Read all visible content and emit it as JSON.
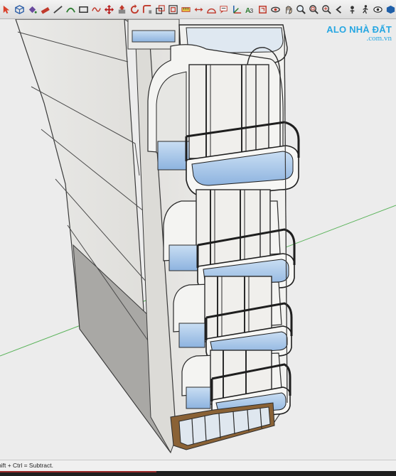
{
  "toolbar": {
    "tools": [
      {
        "icon": "select-arrow-icon",
        "color": "#d9412b"
      },
      {
        "icon": "make-component-icon",
        "color": "#2d5fa8"
      },
      {
        "icon": "paint-bucket-icon",
        "color": "#6a4a9e"
      },
      {
        "icon": "eraser-icon",
        "color": "#c0392b"
      },
      {
        "icon": "line-tool-icon",
        "color": "#444444"
      },
      {
        "icon": "arc-tool-icon",
        "color": "#2e7d32"
      },
      {
        "icon": "rectangle-tool-icon",
        "color": "#333333"
      },
      {
        "icon": "freehand-icon",
        "color": "#c0392b"
      },
      {
        "icon": "move-tool-icon",
        "color": "#b71c1c"
      },
      {
        "icon": "push-pull-icon",
        "color": "#c0392b"
      },
      {
        "icon": "rotate-tool-icon",
        "color": "#c0392b"
      },
      {
        "icon": "follow-me-icon",
        "color": "#c0392b"
      },
      {
        "icon": "scale-tool-icon",
        "color": "#333333"
      },
      {
        "icon": "offset-tool-icon",
        "color": "#333333"
      },
      {
        "icon": "tape-measure-icon",
        "color": "#c0392b"
      },
      {
        "icon": "dimension-icon",
        "color": "#c0392b"
      },
      {
        "icon": "protractor-icon",
        "color": "#c0392b"
      },
      {
        "icon": "text-tool-icon",
        "color": "#c0392b"
      },
      {
        "icon": "axes-tool-icon",
        "color": "#c0392b"
      },
      {
        "icon": "3d-text-icon",
        "color": "#2e7d32"
      },
      {
        "icon": "section-plane-icon",
        "color": "#c0392b"
      },
      {
        "icon": "orbit-icon",
        "color": "#333333"
      },
      {
        "icon": "pan-icon",
        "color": "#333333"
      },
      {
        "icon": "zoom-icon",
        "color": "#333333"
      },
      {
        "icon": "zoom-window-icon",
        "color": "#333333"
      },
      {
        "icon": "zoom-extents-icon",
        "color": "#333333"
      },
      {
        "icon": "previous-view-icon",
        "color": "#333333"
      },
      {
        "icon": "position-camera-icon",
        "color": "#333333"
      },
      {
        "icon": "walk-icon",
        "color": "#333333"
      },
      {
        "icon": "look-around-icon",
        "color": "#333333"
      },
      {
        "icon": "solid-tools-icon",
        "color": "#1f5fa8"
      },
      {
        "icon": "intersect-icon",
        "color": "#1f5fa8"
      },
      {
        "icon": "union-icon",
        "color": "#1f5fa8"
      },
      {
        "icon": "subtract-icon",
        "color": "#1f5fa8"
      },
      {
        "icon": "trim-icon",
        "color": "#1f5fa8"
      },
      {
        "icon": "split-icon",
        "color": "#1f5fa8"
      },
      {
        "icon": "sandbox-icon",
        "color": "#333333"
      },
      {
        "icon": "down-arrow-icon",
        "color": "#333333"
      },
      {
        "icon": "styles-icon",
        "color": "#333333"
      }
    ]
  },
  "watermark": {
    "brand": "ALO NHÀ ĐẤT",
    "domain": ".com.vn",
    "color": "#27a7e2"
  },
  "status": {
    "text": "hift + Ctrl = Subtract."
  },
  "colors": {
    "wall": "#e7e6e3",
    "wall_shade": "#d2d1cd",
    "wall_dark": "#9c9b98",
    "glass": "#8fb6e2",
    "glass_light": "#bcd6f0",
    "frame": "#3a3a3a",
    "wood": "#8a6236",
    "green_axis": "#5ab35a"
  }
}
